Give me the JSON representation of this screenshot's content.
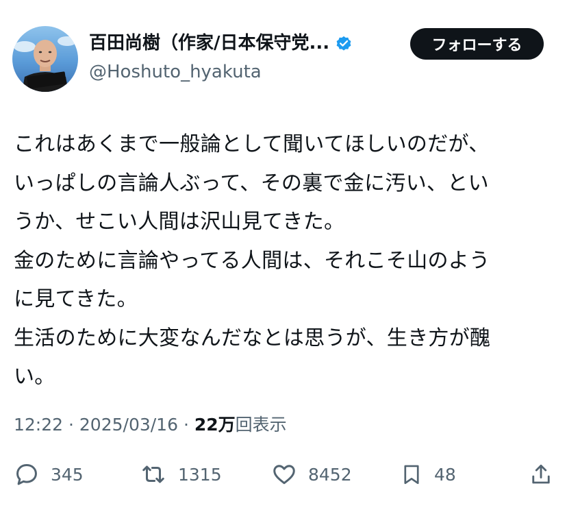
{
  "author": {
    "display_name": "百田尚樹（作家/日本保守党...",
    "handle": "@Hoshuto_hyakuta",
    "avatar_caption": "百田尚樹"
  },
  "follow_button": {
    "label": "フォローする"
  },
  "tweet": {
    "lines": [
      "これはあくまで一般論として聞いてほしいのだが、",
      "いっぱしの言論人ぶって、その裏で金に汚い、とい",
      "うか、せこい人間は沢山見てきた。",
      "金のために言論やってる人間は、それこそ山のよう",
      "に見てきた。",
      "生活のために大変なんだなとは思うが、生き方が醜",
      "い。"
    ]
  },
  "meta": {
    "time": "12:22",
    "separator": "·",
    "date": "2025/03/16",
    "views_count": "22万",
    "views_label": "回表示"
  },
  "actions": {
    "reply": {
      "icon": "reply-icon",
      "count": "345"
    },
    "retweet": {
      "icon": "retweet-icon",
      "count": "1315"
    },
    "like": {
      "icon": "heart-icon",
      "count": "8452"
    },
    "bookmark": {
      "icon": "bookmark-icon",
      "count": "48"
    },
    "share": {
      "icon": "share-icon"
    }
  },
  "colors": {
    "text_primary": "#0f1419",
    "text_secondary": "#536471",
    "verified_blue": "#1d9bf0",
    "button_bg": "#0f1419",
    "button_text": "#ffffff"
  }
}
